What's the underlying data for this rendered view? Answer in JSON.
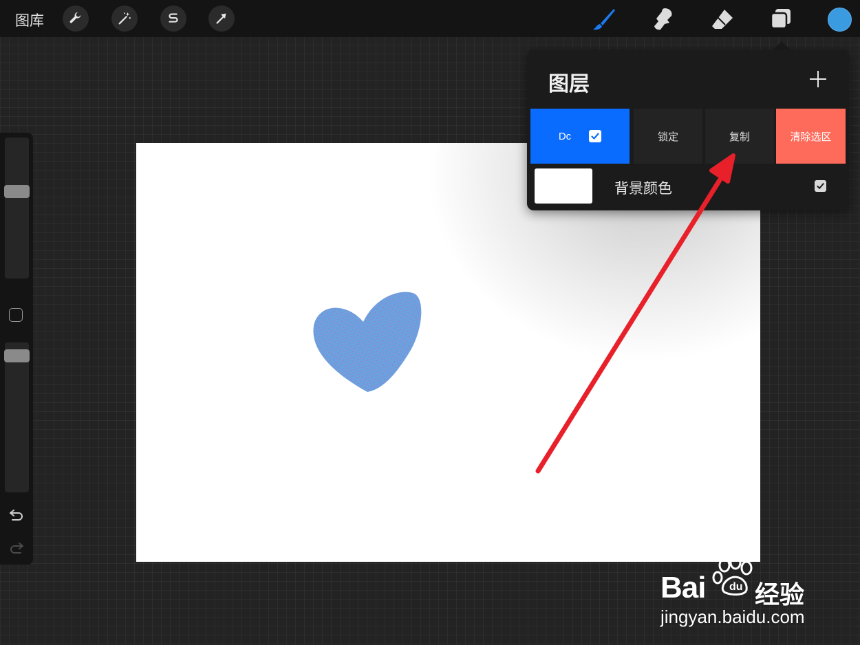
{
  "topbar": {
    "gallery_label": "图库",
    "left_tools": [
      "wrench-icon",
      "magic-wand-icon",
      "selection-icon",
      "transform-arrow-icon"
    ],
    "right_tools": [
      "brush-icon",
      "smudge-icon",
      "eraser-icon",
      "layers-icon"
    ],
    "active_tool": "brush-icon",
    "accent_color": "#1a7cf0",
    "current_color": "#3b9be0"
  },
  "sidebar": {
    "brush_size": 0.63,
    "opacity": 0.95
  },
  "layers_panel": {
    "title": "图层",
    "layer": {
      "name": "Dc",
      "visible": true,
      "color": "#0a6cff"
    },
    "actions": {
      "lock": "锁定",
      "duplicate": "复制",
      "clear_selection": "清除选区"
    },
    "clear_color": "#ff6b5b",
    "background": {
      "label": "背景颜色",
      "visible": true
    }
  },
  "watermark": {
    "brand": "Bai",
    "brand_suffix": "经验",
    "url": "jingyan.baidu.com"
  }
}
